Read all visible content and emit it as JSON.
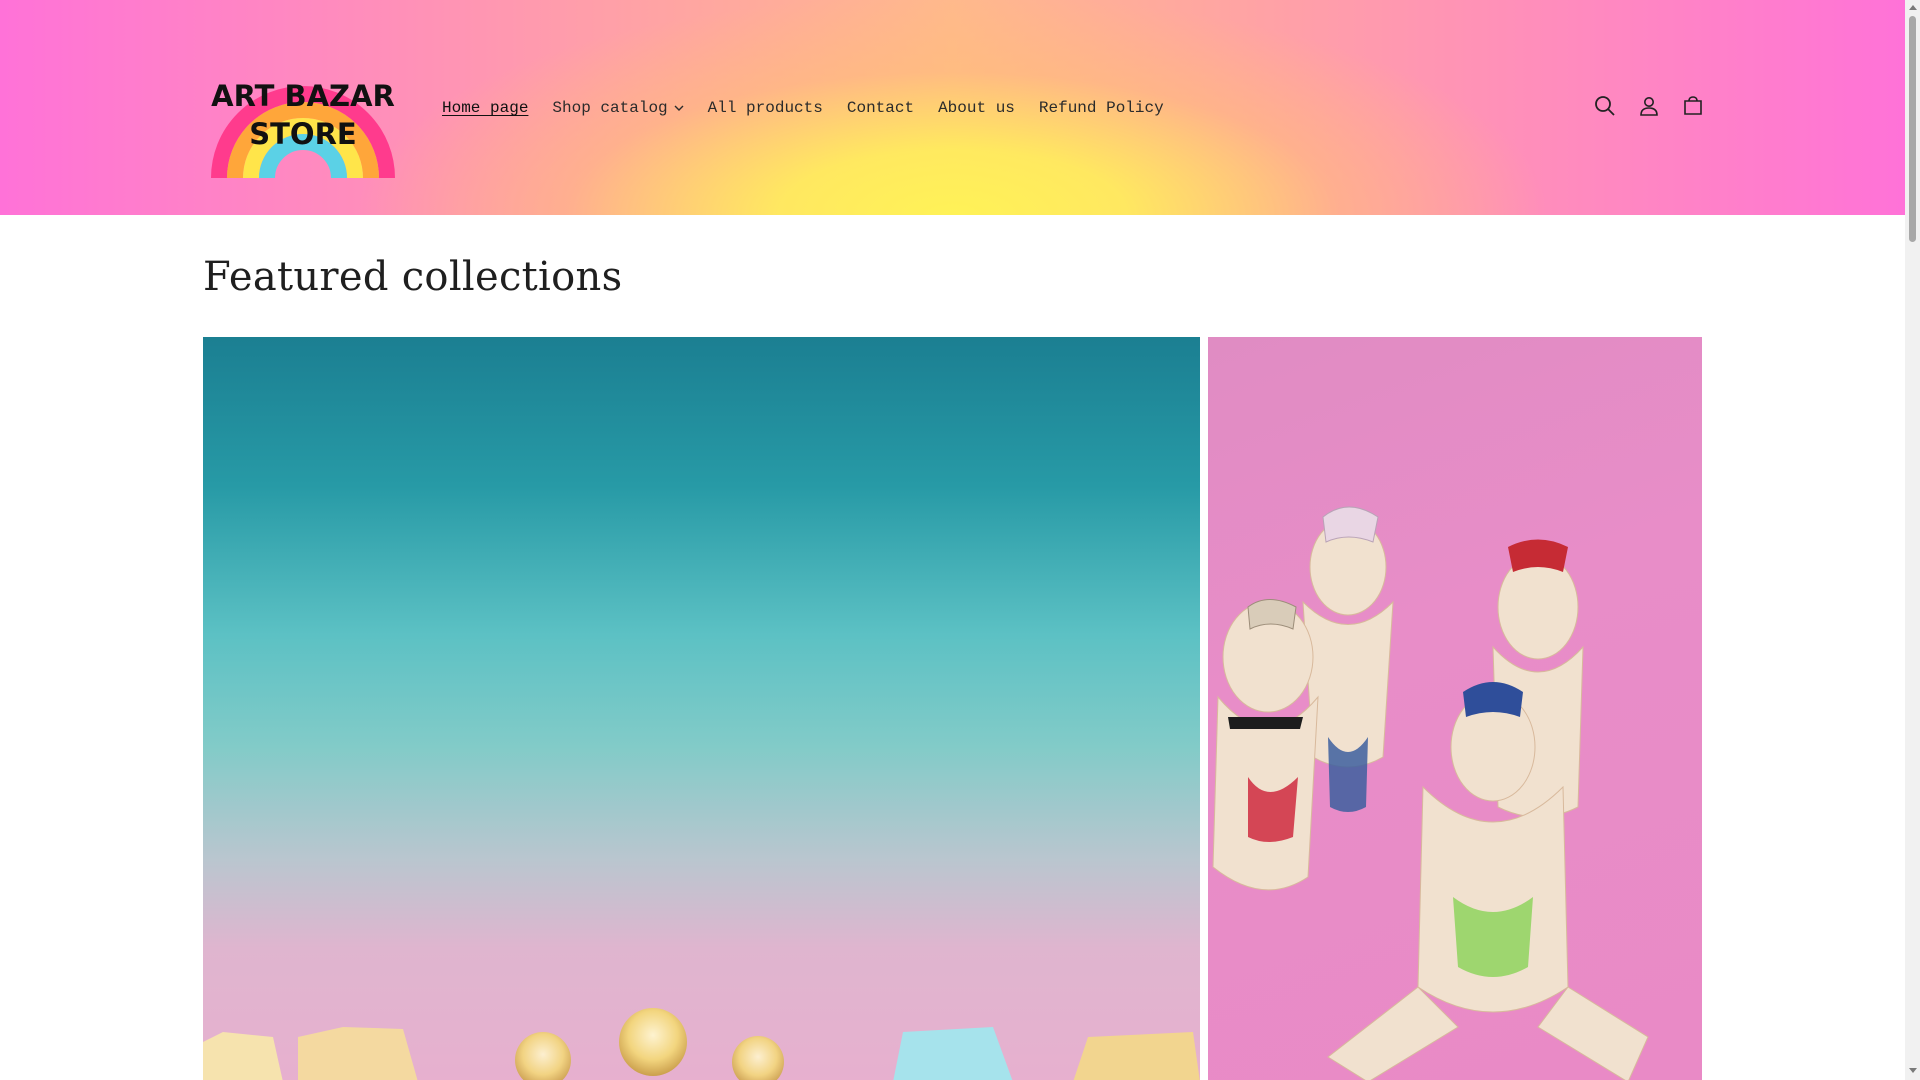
{
  "store": {
    "logo_line1": "ART BAZAR",
    "logo_line2": "STORE"
  },
  "nav": [
    {
      "label": "Home page",
      "active": true
    },
    {
      "label": "Shop catalog",
      "dropdown": true
    },
    {
      "label": "All products"
    },
    {
      "label": "Contact"
    },
    {
      "label": "About us"
    },
    {
      "label": "Refund Policy"
    }
  ],
  "header_icons": [
    "search-icon",
    "account-icon",
    "cart-icon"
  ],
  "main": {
    "section_title": "Featured collections"
  },
  "colors": {
    "header_pink": "#ff72d8",
    "header_yellow": "#fff257",
    "teal": "#1b7f92",
    "pink_bg": "#e88dc8"
  }
}
